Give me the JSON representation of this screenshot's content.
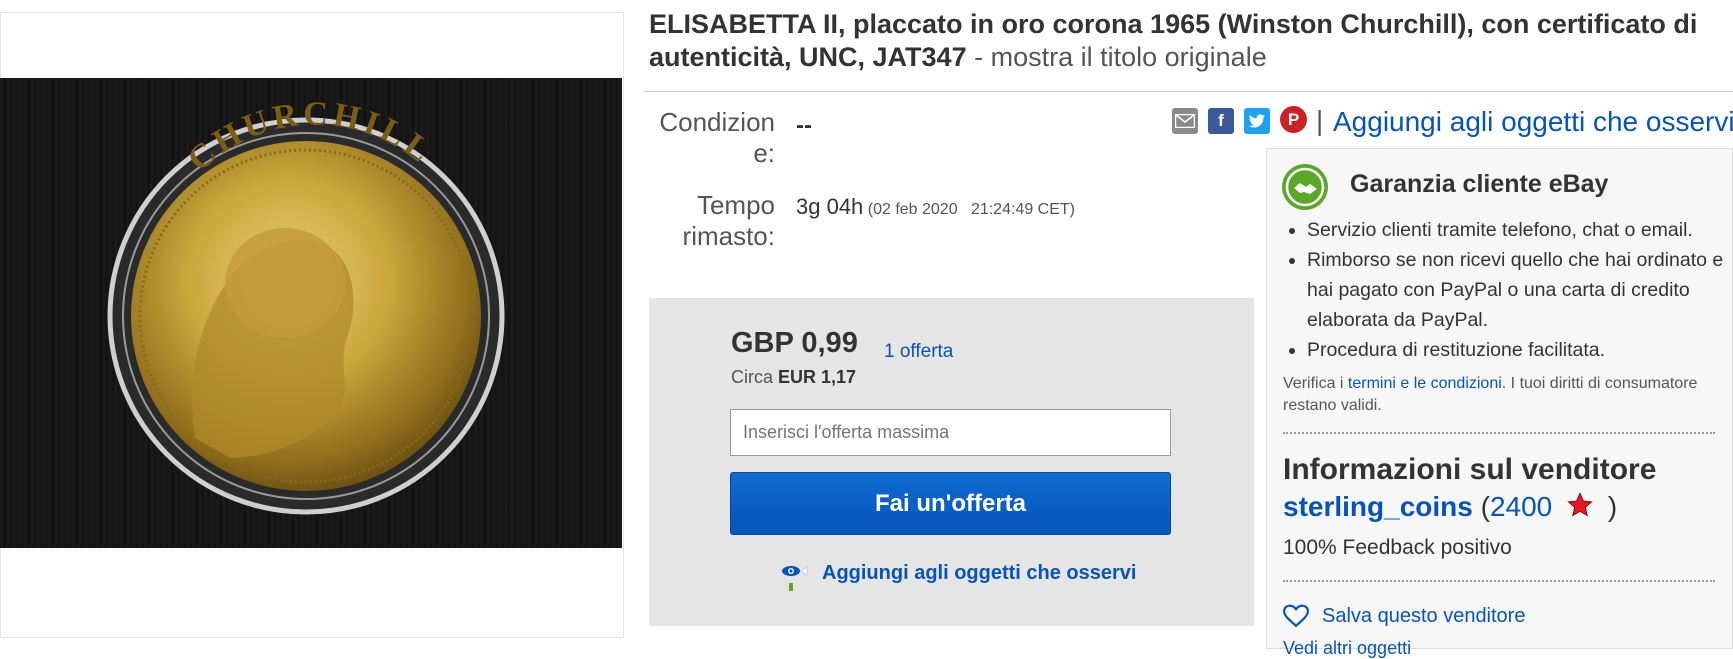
{
  "listing": {
    "title": "ELISABETTA II, placcato in oro corona 1965 (Winston Churchill), con certificato di autenticità, UNC, JAT347",
    "title_separator": " - ",
    "original_title_link": "mostra il titolo originale"
  },
  "coin_image": {
    "inscription": "CHURCHILL"
  },
  "details": {
    "condition_label": "Condizion e:",
    "condition_label_line1": "Condizion",
    "condition_label_line2": "e:",
    "condition_value": "--",
    "time_label_line1": "Tempo",
    "time_label_line2": "rimasto:",
    "time_remaining": "3g 04h",
    "end_date": "(02 feb 2020   21:24:49 CET)"
  },
  "share": {
    "icons": [
      "email-icon",
      "facebook-icon",
      "twitter-icon",
      "pinterest-icon"
    ],
    "separator": "|",
    "watch_link": "Aggiungi agli oggetti che osservi"
  },
  "bid": {
    "price": "GBP 0,99",
    "bid_count": "1 offerta",
    "approx_prefix": "Circa",
    "approx_value": "EUR 1,17",
    "input_placeholder": "Inserisci l'offerta massima",
    "button_label": "Fai un'offerta",
    "watch_label": "Aggiungi agli oggetti che osservi"
  },
  "guarantee": {
    "title": "Garanzia cliente eBay",
    "items": [
      "Servizio clienti tramite telefono, chat o email.",
      "Rimborso se non ricevi quello che hai ordinato e hai pagato con PayPal o una carta di credito elaborata da PayPal.",
      "Procedura di restituzione facilitata."
    ],
    "verify_prefix": "Verifica i",
    "verify_link": "termini e le condizioni",
    "verify_suffix": ". I tuoi diritti di consumatore restano validi."
  },
  "seller": {
    "section_title": "Informazioni sul venditore",
    "name": "sterling_coins",
    "feedback_open": "(",
    "feedback_score": "2400",
    "feedback_close": ")",
    "feedback_percent": "100% Feedback positivo",
    "save_seller": "Salva questo venditore",
    "more_items": "Vedi altri oggetti"
  },
  "colors": {
    "link_blue": "#0654ba",
    "bid_box_bg": "#e5e5e5",
    "button_blue": "#0654ba",
    "star_red": "#e21b23",
    "guarantee_green": "#5ba829"
  }
}
